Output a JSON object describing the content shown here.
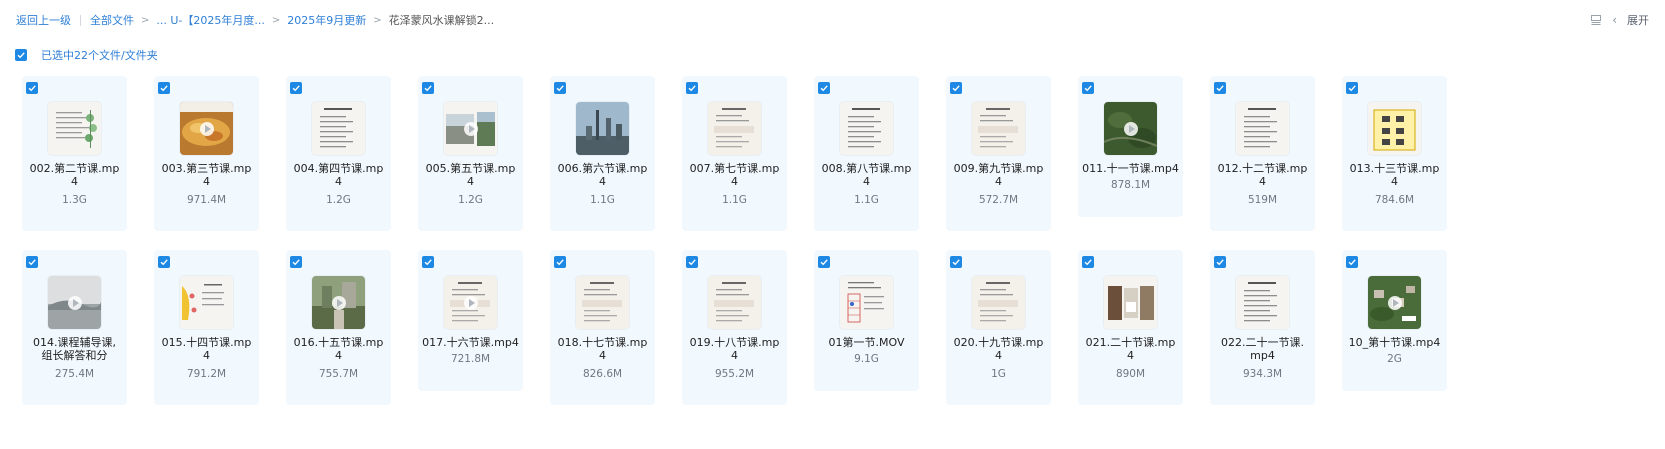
{
  "breadcrumb": {
    "back": "返回上一级",
    "all_files": "全部文件",
    "path_1": "... U-【2025年月度...",
    "path_2": "2025年9月更新",
    "current": "花泽蒙风水课解锁2..."
  },
  "toolbar": {
    "expand_label": "展开"
  },
  "selection": {
    "label": "已选中22个文件/文件夹"
  },
  "accent_color": "#1e88e5",
  "files": [
    {
      "name_l1": "002.第二节课.mp",
      "name_l2": "4",
      "size": "1.3G",
      "thumb": "doc-plant",
      "video": false
    },
    {
      "name_l1": "003.第三节课.mp",
      "name_l2": "4",
      "size": "971.4M",
      "thumb": "food",
      "video": true
    },
    {
      "name_l1": "004.第四节课.mp",
      "name_l2": "4",
      "size": "1.2G",
      "thumb": "doc",
      "video": false
    },
    {
      "name_l1": "005.第五节课.mp",
      "name_l2": "4",
      "size": "1.2G",
      "thumb": "photos",
      "video": true
    },
    {
      "name_l1": "006.第六节课.mp",
      "name_l2": "4",
      "size": "1.1G",
      "thumb": "city",
      "video": false
    },
    {
      "name_l1": "007.第七节课.mp",
      "name_l2": "4",
      "size": "1.1G",
      "thumb": "doc-watermark",
      "video": false
    },
    {
      "name_l1": "008.第八节课.mp",
      "name_l2": "4",
      "size": "1.1G",
      "thumb": "doc",
      "video": false
    },
    {
      "name_l1": "009.第九节课.mp",
      "name_l2": "4",
      "size": "572.7M",
      "thumb": "doc-watermark",
      "video": false
    },
    {
      "name_l1": "011.十一节课.mp4",
      "name_l2": "",
      "size": "878.1M",
      "thumb": "aerial",
      "video": true
    },
    {
      "name_l1": "012.十二节课.mp",
      "name_l2": "4",
      "size": "519M",
      "thumb": "doc",
      "video": false
    },
    {
      "name_l1": "013.十三节课.mp",
      "name_l2": "4",
      "size": "784.6M",
      "thumb": "grid-yellow",
      "video": false
    },
    {
      "name_l1": "014.课程辅导课,",
      "name_l2": "组长解答和分",
      "size": "275.4M",
      "thumb": "landscape-grey",
      "video": true
    },
    {
      "name_l1": "015.十四节课.mp",
      "name_l2": "4",
      "size": "791.2M",
      "thumb": "doc-yellow",
      "video": false
    },
    {
      "name_l1": "016.十五节课.mp",
      "name_l2": "4",
      "size": "755.7M",
      "thumb": "garden",
      "video": true
    },
    {
      "name_l1": "017.十六节课.mp4",
      "name_l2": "",
      "size": "721.8M",
      "thumb": "doc-watermark",
      "video": true
    },
    {
      "name_l1": "018.十七节课.mp",
      "name_l2": "4",
      "size": "826.6M",
      "thumb": "doc-watermark",
      "video": false
    },
    {
      "name_l1": "019.十八节课.mp",
      "name_l2": "4",
      "size": "955.2M",
      "thumb": "doc-watermark",
      "video": false
    },
    {
      "name_l1": "01第一节.MOV",
      "name_l2": "",
      "size": "9.1G",
      "thumb": "doc-table",
      "video": false
    },
    {
      "name_l1": "020.十九节课.mp",
      "name_l2": "4",
      "size": "1G",
      "thumb": "doc-watermark",
      "video": false
    },
    {
      "name_l1": "021.二十节课.mp",
      "name_l2": "4",
      "size": "890M",
      "thumb": "rooms",
      "video": false
    },
    {
      "name_l1": "022.二十一节课.",
      "name_l2": "mp4",
      "size": "934.3M",
      "thumb": "doc",
      "video": false
    },
    {
      "name_l1": "10_第十节课.mp4",
      "name_l2": "",
      "size": "2G",
      "thumb": "village",
      "video": true
    }
  ]
}
